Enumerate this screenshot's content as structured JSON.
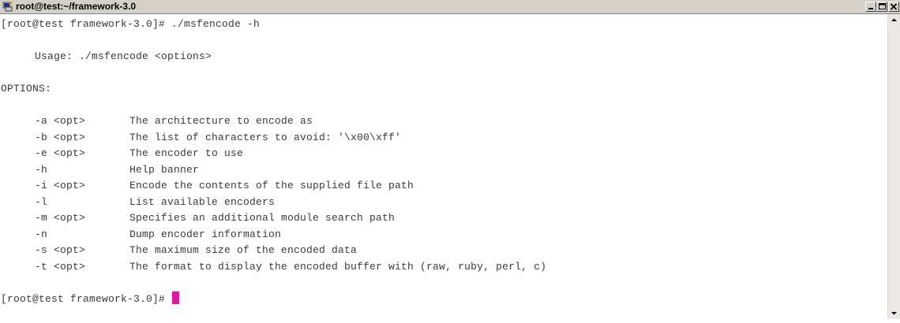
{
  "window": {
    "title": "root@test:~/framework-3.0",
    "icon": "putty-icon"
  },
  "terminal": {
    "prompt_command": "[root@test framework-3.0]# ./msfencode -h",
    "usage": "Usage: ./msfencode <options>",
    "options_header": "OPTIONS:",
    "options": [
      {
        "flag": "-a <opt>",
        "desc": "The architecture to encode as"
      },
      {
        "flag": "-b <opt>",
        "desc": "The list of characters to avoid: '\\x00\\xff'"
      },
      {
        "flag": "-e <opt>",
        "desc": "The encoder to use"
      },
      {
        "flag": "-h",
        "desc": "Help banner"
      },
      {
        "flag": "-i <opt>",
        "desc": "Encode the contents of the supplied file path"
      },
      {
        "flag": "-l",
        "desc": "List available encoders"
      },
      {
        "flag": "-m <opt>",
        "desc": "Specifies an additional module search path"
      },
      {
        "flag": "-n",
        "desc": "Dump encoder information"
      },
      {
        "flag": "-s <opt>",
        "desc": "The maximum size of the encoded data"
      },
      {
        "flag": "-t <opt>",
        "desc": "The format to display the encoded buffer with (raw, ruby, perl, c)"
      }
    ],
    "final_prompt": "[root@test framework-3.0]# ",
    "cursor_color": "#e0189e"
  }
}
